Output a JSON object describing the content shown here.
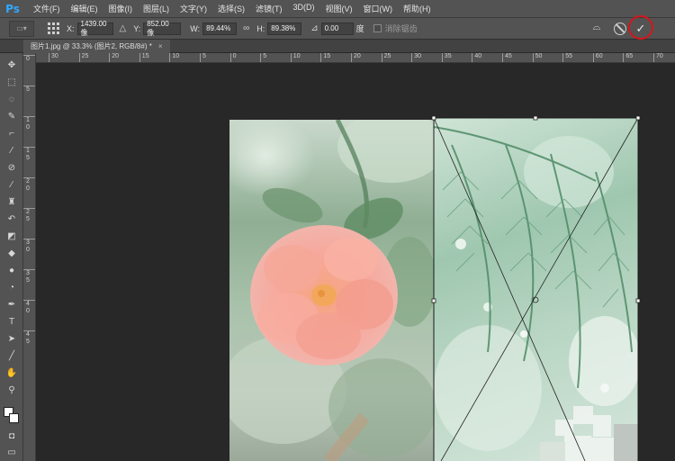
{
  "app": {
    "logo": "Ps"
  },
  "menu": [
    "文件(F)",
    "编辑(E)",
    "图像(I)",
    "图层(L)",
    "文字(Y)",
    "选择(S)",
    "滤镜(T)",
    "3D(D)",
    "视图(V)",
    "窗口(W)",
    "帮助(H)"
  ],
  "options": {
    "x_label": "X:",
    "x_value": "1439.00 像",
    "delta_symbol": "△",
    "y_label": "Y:",
    "y_value": "852.00 像",
    "w_label": "W:",
    "w_value": "89.44%",
    "link_symbol": "∞",
    "h_label": "H:",
    "h_value": "89.38%",
    "angle_symbol": "⊿",
    "angle_value": "0.00",
    "angle_unit": "度",
    "antialias_label": "消除锯齿"
  },
  "document": {
    "tab_title": "图片1.jpg @ 33.3% (图片2, RGB/8#) *",
    "close": "×"
  },
  "ruler_top": [
    "30",
    "25",
    "20",
    "15",
    "10",
    "5",
    "0",
    "5",
    "10",
    "15",
    "20",
    "25",
    "30",
    "35",
    "40",
    "45",
    "50",
    "55",
    "60",
    "65",
    "70"
  ],
  "ruler_left": [
    "0",
    "5",
    "1\n0",
    "1\n5",
    "2\n0",
    "2\n5",
    "3\n0",
    "3\n5",
    "4\n0",
    "4\n5"
  ],
  "icons": {
    "commit": "check-icon",
    "cancel": "cancel-icon",
    "warp": "warp-icon"
  },
  "colors": {
    "commit_highlight": "#d4161b",
    "ps_blue": "#31a8ff"
  }
}
